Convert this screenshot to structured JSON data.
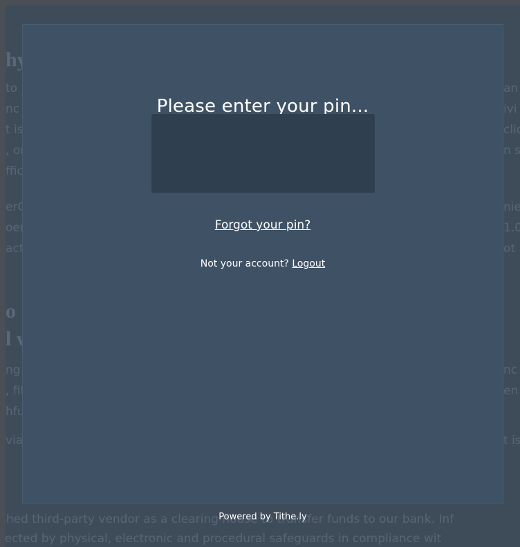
{
  "background": {
    "heading_1": "hy",
    "heading_2": "o",
    "heading_3": "l w",
    "left_fragments": [
      "to l",
      "nc",
      "t is",
      ", or",
      "ffic",
      "erC",
      "oer",
      "act",
      "ng i",
      ", fit",
      "hfu",
      "via"
    ],
    "right_fragments": [
      "an",
      "ivi",
      "clic",
      "n st",
      "nie",
      "1.0",
      "ot",
      "nc",
      "en",
      "t is"
    ],
    "bottom_line_1": "shed third-party vendor as a clearing house to transfer funds to our bank. Inf",
    "bottom_line_2": "tected by physical, electronic and procedural safeguards in compliance wit"
  },
  "modal": {
    "title": "Please enter your pin...",
    "pin_value": "",
    "forgot_pin_label": "Forgot your pin?",
    "not_your_account_text": "Not your account?",
    "logout_label": "Logout",
    "powered_by_text": "Powered by Tithe.ly"
  },
  "colors": {
    "overlay": "#4a4f55",
    "modal_bg": "#3f5164",
    "input_bg": "#2f3f50",
    "text": "#ffffff"
  }
}
